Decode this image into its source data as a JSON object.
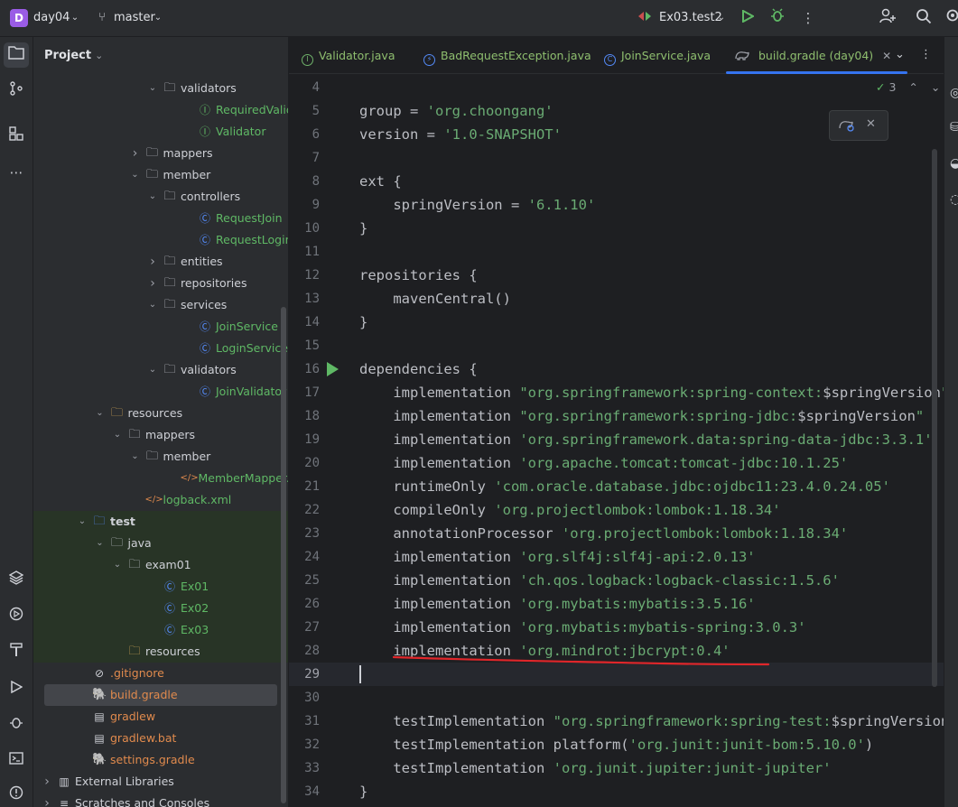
{
  "titlebar": {
    "project_badge": "D",
    "project_name": "day04",
    "branch": "master",
    "run_config": "Ex03.test2"
  },
  "project_panel": {
    "title": "Project",
    "tree": [
      {
        "label": "validators",
        "kind": "folder",
        "indent": 6,
        "expanded": true,
        "color": "folder"
      },
      {
        "label": "RequiredValidator",
        "kind": "interface",
        "indent": 8,
        "color": "green"
      },
      {
        "label": "Validator",
        "kind": "interface",
        "indent": 8,
        "color": "green"
      },
      {
        "label": "mappers",
        "kind": "folder",
        "indent": 5,
        "expanded": false,
        "color": "folder"
      },
      {
        "label": "member",
        "kind": "folder",
        "indent": 5,
        "expanded": true,
        "color": "folder"
      },
      {
        "label": "controllers",
        "kind": "folder",
        "indent": 6,
        "expanded": true,
        "color": "folder"
      },
      {
        "label": "RequestJoin",
        "kind": "class",
        "indent": 8,
        "color": "green"
      },
      {
        "label": "RequestLogin",
        "kind": "class",
        "indent": 8,
        "color": "green"
      },
      {
        "label": "entities",
        "kind": "folder",
        "indent": 6,
        "expanded": false,
        "color": "folder"
      },
      {
        "label": "repositories",
        "kind": "folder",
        "indent": 6,
        "expanded": false,
        "color": "folder"
      },
      {
        "label": "services",
        "kind": "folder",
        "indent": 6,
        "expanded": true,
        "color": "folder"
      },
      {
        "label": "JoinService",
        "kind": "class",
        "indent": 8,
        "color": "green"
      },
      {
        "label": "LoginService",
        "kind": "class",
        "indent": 8,
        "color": "green"
      },
      {
        "label": "validators",
        "kind": "folder",
        "indent": 6,
        "expanded": true,
        "color": "folder"
      },
      {
        "label": "JoinValidator",
        "kind": "class",
        "indent": 8,
        "color": "green"
      },
      {
        "label": "resources",
        "kind": "res-folder",
        "indent": 3,
        "expanded": true,
        "color": "folder"
      },
      {
        "label": "mappers",
        "kind": "folder",
        "indent": 4,
        "expanded": true,
        "color": "folder"
      },
      {
        "label": "member",
        "kind": "folder",
        "indent": 5,
        "expanded": true,
        "color": "folder"
      },
      {
        "label": "MemberMapper.xml",
        "kind": "xml",
        "indent": 7,
        "color": "green"
      },
      {
        "label": "logback.xml",
        "kind": "xml",
        "indent": 5,
        "color": "green"
      },
      {
        "label": "test",
        "kind": "test-folder",
        "indent": 2,
        "expanded": true,
        "color": "folder",
        "test": true
      },
      {
        "label": "java",
        "kind": "folder",
        "indent": 3,
        "expanded": true,
        "color": "folder",
        "test": true
      },
      {
        "label": "exam01",
        "kind": "folder",
        "indent": 4,
        "expanded": true,
        "color": "folder",
        "test": true
      },
      {
        "label": "Ex01",
        "kind": "test-class",
        "indent": 6,
        "color": "green",
        "test": true
      },
      {
        "label": "Ex02",
        "kind": "test-class",
        "indent": 6,
        "color": "green",
        "test": true
      },
      {
        "label": "Ex03",
        "kind": "test-class",
        "indent": 6,
        "color": "green",
        "test": true
      },
      {
        "label": "resources",
        "kind": "res-folder",
        "indent": 4,
        "color": "folder",
        "test": true
      },
      {
        "label": ".gitignore",
        "kind": "ignore",
        "indent": 2,
        "color": "orange"
      },
      {
        "label": "build.gradle",
        "kind": "gradle",
        "indent": 2,
        "color": "orange",
        "selected": true
      },
      {
        "label": "gradlew",
        "kind": "file",
        "indent": 2,
        "color": "orange"
      },
      {
        "label": "gradlew.bat",
        "kind": "file",
        "indent": 2,
        "color": "orange"
      },
      {
        "label": "settings.gradle",
        "kind": "gradle",
        "indent": 2,
        "color": "orange"
      },
      {
        "label": "External Libraries",
        "kind": "lib",
        "indent": 0,
        "expanded": false,
        "color": "folder"
      },
      {
        "label": "Scratches and Consoles",
        "kind": "scratch",
        "indent": 0,
        "expanded": false,
        "color": "folder"
      }
    ]
  },
  "editor": {
    "tabs": [
      {
        "label": "Validator.java",
        "icon": "interface",
        "active": false
      },
      {
        "label": "BadRequestException.java",
        "icon": "exception",
        "active": false
      },
      {
        "label": "JoinService.java",
        "icon": "class",
        "active": false
      },
      {
        "label": "build.gradle (day04)",
        "icon": "gradle",
        "active": true
      }
    ],
    "inspection_count": "3",
    "current_line": 29,
    "lines": [
      {
        "n": "4",
        "parts": []
      },
      {
        "n": "5",
        "parts": [
          [
            "t",
            "group = "
          ],
          [
            "s",
            "'org.choongang'"
          ]
        ]
      },
      {
        "n": "6",
        "parts": [
          [
            "t",
            "version = "
          ],
          [
            "s",
            "'1.0-SNAPSHOT'"
          ]
        ]
      },
      {
        "n": "7",
        "parts": []
      },
      {
        "n": "8",
        "parts": [
          [
            "t",
            "ext {"
          ]
        ]
      },
      {
        "n": "9",
        "parts": [
          [
            "t",
            "    springVersion = "
          ],
          [
            "s",
            "'6.1.10'"
          ]
        ]
      },
      {
        "n": "10",
        "parts": [
          [
            "t",
            "}"
          ]
        ]
      },
      {
        "n": "11",
        "parts": []
      },
      {
        "n": "12",
        "parts": [
          [
            "t",
            "repositories {"
          ]
        ]
      },
      {
        "n": "13",
        "parts": [
          [
            "t",
            "    mavenCentral()"
          ]
        ]
      },
      {
        "n": "14",
        "parts": [
          [
            "t",
            "}"
          ]
        ]
      },
      {
        "n": "15",
        "parts": []
      },
      {
        "n": "16",
        "parts": [
          [
            "t",
            "dependencies {"
          ]
        ],
        "run": true
      },
      {
        "n": "17",
        "parts": [
          [
            "t",
            "    implementation "
          ],
          [
            "s",
            "\"org.springframework:spring-context:"
          ],
          [
            "t",
            "$springVersion"
          ],
          [
            "s",
            "\""
          ]
        ]
      },
      {
        "n": "18",
        "parts": [
          [
            "t",
            "    implementation "
          ],
          [
            "s",
            "\"org.springframework:spring-jdbc:"
          ],
          [
            "t",
            "$springVersion"
          ],
          [
            "s",
            "\""
          ]
        ]
      },
      {
        "n": "19",
        "parts": [
          [
            "t",
            "    implementation "
          ],
          [
            "s",
            "'org.springframework.data:spring-data-jdbc:3.3.1'"
          ]
        ]
      },
      {
        "n": "20",
        "parts": [
          [
            "t",
            "    implementation "
          ],
          [
            "s",
            "'org.apache.tomcat:tomcat-jdbc:10.1.25'"
          ]
        ]
      },
      {
        "n": "21",
        "parts": [
          [
            "t",
            "    runtimeOnly "
          ],
          [
            "s",
            "'com.oracle.database.jdbc:ojdbc11:23.4.0.24.05'"
          ]
        ]
      },
      {
        "n": "22",
        "parts": [
          [
            "t",
            "    compileOnly "
          ],
          [
            "s",
            "'org.projectlombok:lombok:1.18.34'"
          ]
        ]
      },
      {
        "n": "23",
        "parts": [
          [
            "t",
            "    annotationProcessor "
          ],
          [
            "s",
            "'org.projectlombok:lombok:1.18.34'"
          ]
        ]
      },
      {
        "n": "24",
        "parts": [
          [
            "t",
            "    implementation "
          ],
          [
            "s",
            "'org.slf4j:slf4j-api:2.0.13'"
          ]
        ]
      },
      {
        "n": "25",
        "parts": [
          [
            "t",
            "    implementation "
          ],
          [
            "s",
            "'ch.qos.logback:logback-classic:1.5.6'"
          ]
        ]
      },
      {
        "n": "26",
        "parts": [
          [
            "t",
            "    implementation "
          ],
          [
            "s",
            "'org.mybatis:mybatis:3.5.16'"
          ]
        ]
      },
      {
        "n": "27",
        "parts": [
          [
            "t",
            "    implementation "
          ],
          [
            "s",
            "'org.mybatis:mybatis-spring:3.0.3'"
          ]
        ]
      },
      {
        "n": "28",
        "parts": [
          [
            "t",
            "    implementation "
          ],
          [
            "s",
            "'org.mindrot:jbcrypt:0.4'"
          ]
        ]
      },
      {
        "n": "29",
        "parts": []
      },
      {
        "n": "30",
        "parts": []
      },
      {
        "n": "31",
        "parts": [
          [
            "t",
            "    testImplementation "
          ],
          [
            "s",
            "\"org.springframework:spring-test:"
          ],
          [
            "t",
            "$springVersion"
          ],
          [
            "s",
            "\""
          ]
        ]
      },
      {
        "n": "32",
        "parts": [
          [
            "t",
            "    testImplementation platform("
          ],
          [
            "s",
            "'org.junit:junit-bom:5.10.0'"
          ],
          [
            "t",
            ")"
          ]
        ]
      },
      {
        "n": "33",
        "parts": [
          [
            "t",
            "    testImplementation "
          ],
          [
            "s",
            "'org.junit.jupiter:junit-jupiter'"
          ]
        ]
      },
      {
        "n": "34",
        "parts": [
          [
            "t",
            "}"
          ]
        ]
      }
    ]
  },
  "colors": {
    "string": "#6aab73",
    "text": "#bcbec4",
    "accent": "#3574f0",
    "annotation": "#e0262a"
  }
}
